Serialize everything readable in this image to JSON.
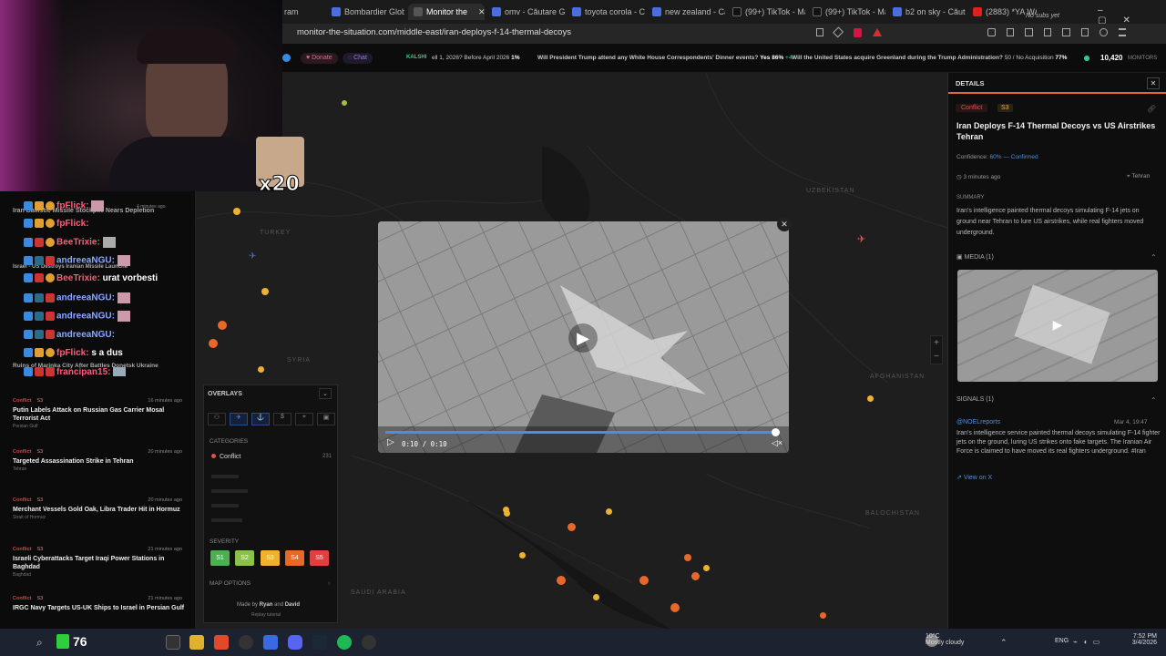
{
  "browser": {
    "tabs": [
      {
        "label": "ram",
        "active": false
      },
      {
        "label": "Bombardier Glob",
        "active": false
      },
      {
        "label": "Monitor the",
        "active": true
      },
      {
        "label": "omv - Căutare G",
        "active": false
      },
      {
        "label": "toyota corola - C",
        "active": false
      },
      {
        "label": "new zealand - Ca",
        "active": false
      },
      {
        "label": "(99+) TikTok - Ma",
        "active": false
      },
      {
        "label": "(99+) TikTok - Ma",
        "active": false
      },
      {
        "label": "b2 on sky - Căut",
        "active": false
      },
      {
        "label": "(2883) *YA WAH",
        "active": false
      }
    ],
    "url": "monitor-the-situation.com/middle-east/iran-deploys-f-14-thermal-decoys",
    "no_subs": "No subs yet"
  },
  "header": {
    "donate": "Donate",
    "chat": "Chat",
    "kalshi": "KALSHI",
    "ticker": [
      {
        "text": "ell 1, 2026? Before April 2026",
        "pct": "1%"
      },
      {
        "text": "Will President Trump attend any White House Correspondents' Dinner events?",
        "pct": "Yes 86%",
        "delta": "+4"
      },
      {
        "text": "Will the United States acquire Greenland during the Trump Administration?",
        "pct": "50 / No Acquisition",
        "pct2": "77%"
      }
    ],
    "monitors_count": "10,420",
    "monitors_label": "MONITORS"
  },
  "feed": {
    "items": [
      {
        "badge": "Conflict",
        "sev": "S3",
        "time": "16 minutes ago",
        "title": "Putin Labels Attack on Russian Gas Carrier Mosal Terrorist Act",
        "sub": "Persian Gulf"
      },
      {
        "badge": "Conflict",
        "sev": "S3",
        "time": "20 minutes ago",
        "title": "Targeted Assassination Strike in Tehran",
        "sub": "Tehran"
      },
      {
        "badge": "Conflict",
        "sev": "S3",
        "time": "20 minutes ago",
        "title": "Merchant Vessels Gold Oak, Libra Trader Hit in Hormuz",
        "sub": "Strait of Hormuz"
      },
      {
        "badge": "Conflict",
        "sev": "S3",
        "time": "21 minutes ago",
        "title": "Israeli Cyberattacks Target Iraqi Power Stations in Baghdad",
        "sub": "Baghdad"
      },
      {
        "badge": "Conflict",
        "sev": "S3",
        "time": "21 minutes ago",
        "title": "IRGC Navy Targets US-UK Ships to Israel in Persian Gulf",
        "sub": ""
      }
    ],
    "partial_titles": [
      "Iran Ballistic Missile Stockpile Nears Depletion",
      "Israel - US Destroys Iranian Missile Launche",
      "Ruins of Marinka City After Battles Donetsk Ukraine"
    ],
    "top_time": "4 minutes ago"
  },
  "chat": {
    "emote_counter": "x20",
    "lines": [
      {
        "user": "fpFlick:",
        "msg": "",
        "color": "#ff5a7a"
      },
      {
        "user": "fpFlick:",
        "msg": "",
        "color": "#ff5a7a"
      },
      {
        "user": "BeeTrixie:",
        "msg": "",
        "color": "#ff5a7a"
      },
      {
        "user": "andreeaNGU:",
        "msg": "",
        "color": "#8aa8ff"
      },
      {
        "user": "BeeTrixie:",
        "msg": "urat vorbesti",
        "color": "#ff5a7a"
      },
      {
        "user": "andreeaNGU:",
        "msg": "",
        "color": "#8aa8ff"
      },
      {
        "user": "andreeaNGU:",
        "msg": "",
        "color": "#8aa8ff"
      },
      {
        "user": "andreeaNGU:",
        "msg": "",
        "color": "#8aa8ff"
      },
      {
        "user": "fpFlick:",
        "msg": "s a dus",
        "color": "#ff5a7a"
      },
      {
        "user": "francipan15:",
        "msg": "",
        "color": "#ff5a7a"
      }
    ]
  },
  "overlays": {
    "title": "OVERLAYS",
    "categories_label": "CATEGORIES",
    "categories": [
      {
        "name": "Conflict",
        "count": "231"
      }
    ],
    "severity_label": "SEVERITY",
    "severity": [
      "S1",
      "S2",
      "S3",
      "S4",
      "S5"
    ],
    "map_options": "MAP OPTIONS",
    "made_by_prefix": "Made by",
    "made_by_a": "Ryan",
    "made_by_and": "and",
    "made_by_b": "David",
    "replay": "Replay tutorial"
  },
  "map_labels": [
    "TURKEY",
    "SYRIA",
    "UZBEKISTAN",
    "AFGHANISTAN",
    "BALOCHISTAN",
    "SAUDI ARABIA"
  ],
  "video": {
    "time": "0:10 / 0:10",
    "progress": 1.0
  },
  "details": {
    "header": "DETAILS",
    "badge": "Conflict",
    "sev": "S3",
    "title": "Iran Deploys F-14 Thermal Decoys vs US Airstrikes Tehran",
    "confidence_label": "Confidence:",
    "confidence_value": "60% — Confirmed",
    "time": "3 minutes ago",
    "location": "Tehran",
    "summary_label": "SUMMARY",
    "summary": "Iran's intelligence painted thermal decoys simulating F-14 jets on ground near Tehran to lure US airstrikes, while real fighters moved underground.",
    "media_label": "MEDIA (1)",
    "signals_label": "SIGNALS (1)",
    "signal_author": "@NOELreports",
    "signal_date": "Mar 4, 19:47",
    "signal_text": "Iran's intelligence service painted thermal decoys simulating F-14 fighter jets on the ground, luring US strikes onto fake targets. The Iranian Air Force is claimed to have moved its real fighters underground. #Iran",
    "view_on_x": "View on X"
  },
  "taskbar": {
    "temp": "10°C",
    "weather": "Mostly cloudy",
    "lang": "ENG",
    "time": "7:52 PM",
    "date": "3/4/2026",
    "counter": "76"
  },
  "colors": {
    "accent": "#e8682a",
    "conflict": "#e05050",
    "link": "#4a90e2",
    "chat_red": "#ff5a7a"
  }
}
